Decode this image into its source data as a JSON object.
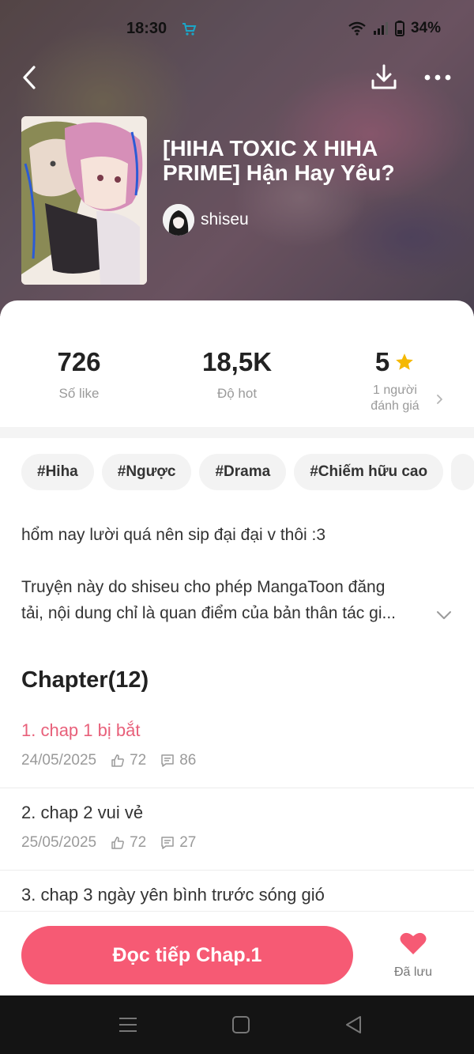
{
  "status": {
    "time": "18:30",
    "battery": "34%"
  },
  "story": {
    "title": "[HIHA TOXIC X HIHA PRIME] Hận Hay Yêu?",
    "author": "shiseu"
  },
  "stats": {
    "likes": {
      "value": "726",
      "label": "Số like"
    },
    "hot": {
      "value": "18,5K",
      "label": "Độ hot"
    },
    "rating": {
      "value": "5",
      "label_line1": "1 người",
      "label_line2": "đánh giá"
    }
  },
  "tags": [
    "#Hiha",
    "#Ngược",
    "#Drama",
    "#Chiếm hữu cao"
  ],
  "description": {
    "line1": "hổm nay lười quá nên sip đại đại v thôi :3",
    "line2": "Truyện này do shiseu cho phép MangaToon đăng",
    "line3": "tải, nội dung chỉ là quan điểm của bản thân tác gi..."
  },
  "chapters": {
    "header": "Chapter(12)",
    "items": [
      {
        "title": "1. chap 1 bị bắt",
        "date": "24/05/2025",
        "likes": "72",
        "comments": "86"
      },
      {
        "title": "2. chap 2 vui vẻ",
        "date": "25/05/2025",
        "likes": "72",
        "comments": "27"
      },
      {
        "title": "3. chap 3 ngày yên bình trước sóng gió"
      }
    ]
  },
  "actions": {
    "read_button": "Đọc tiếp Chap.1",
    "saved_label": "Đã lưu"
  },
  "colors": {
    "accent": "#f65a74",
    "active_chapter": "#e8607a",
    "star": "#f5b800"
  },
  "icons": [
    "back-icon",
    "download-icon",
    "more-icon",
    "star-icon",
    "like-icon",
    "comment-icon",
    "heart-icon",
    "chevron-down-icon",
    "chevron-right-icon"
  ]
}
